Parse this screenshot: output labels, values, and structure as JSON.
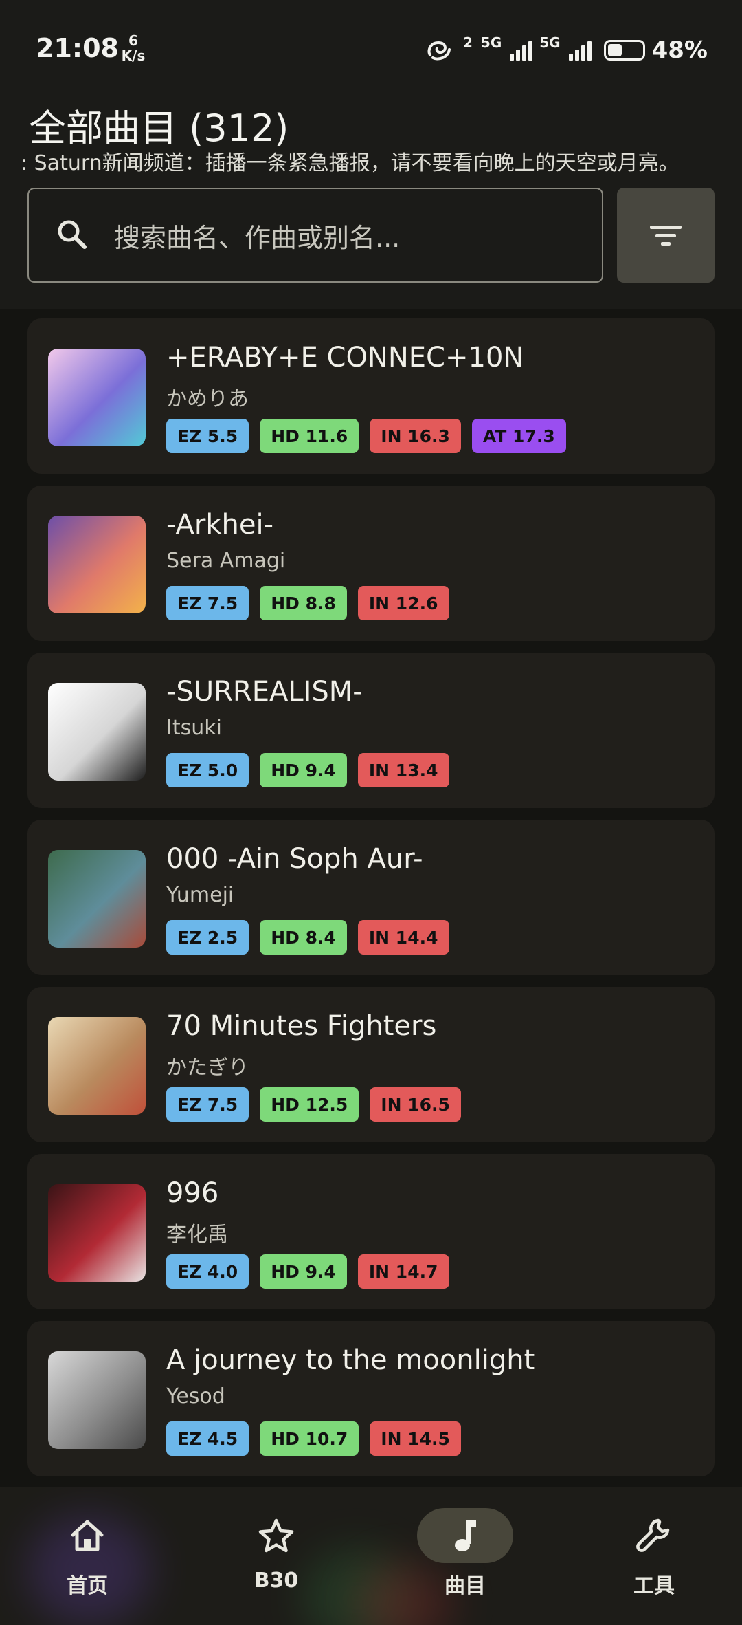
{
  "status_bar": {
    "time": "21:08",
    "speed_value": "6",
    "speed_unit": "K/s",
    "hd_label": "2",
    "network1": "5G",
    "network2": "5G",
    "battery_level": 0.48,
    "battery_percent": "48%"
  },
  "header": {
    "title": "全部曲目 (312)",
    "announcement": ": Saturn新闻频道：插播一条紧急播报，请不要看向晚上的天空或月亮。"
  },
  "search": {
    "placeholder": "搜索曲名、作曲或别名...",
    "icon": "search-icon",
    "filter_icon": "filter-icon"
  },
  "colors": {
    "EZ": "#6cb7ea",
    "HD": "#7ed97a",
    "IN": "#e35a5a",
    "AT": "#9a4ef0"
  },
  "songs": [
    {
      "title": "+ERABY+E CONNEC+10N",
      "artist": "かめりあ",
      "charts": [
        {
          "label": "EZ 5.5",
          "kind": "EZ"
        },
        {
          "label": "HD 11.6",
          "kind": "HD"
        },
        {
          "label": "IN 16.3",
          "kind": "IN"
        },
        {
          "label": "AT 17.3",
          "kind": "AT"
        }
      ],
      "cover": [
        "#f2c9ea",
        "#7b6fd8",
        "#53c9d6"
      ]
    },
    {
      "title": "-Arkhei-",
      "artist": "Sera Amagi",
      "charts": [
        {
          "label": "EZ 7.5",
          "kind": "EZ"
        },
        {
          "label": "HD 8.8",
          "kind": "HD"
        },
        {
          "label": "IN 12.6",
          "kind": "IN"
        }
      ],
      "cover": [
        "#6d4fa8",
        "#e07a6a",
        "#f3b24a"
      ]
    },
    {
      "title": "-SURREALISM-",
      "artist": "Itsuki",
      "charts": [
        {
          "label": "EZ 5.0",
          "kind": "EZ"
        },
        {
          "label": "HD 9.4",
          "kind": "HD"
        },
        {
          "label": "IN 13.4",
          "kind": "IN"
        }
      ],
      "cover": [
        "#ffffff",
        "#d6d6d6",
        "#1e1e1e"
      ]
    },
    {
      "title": "000 -Ain Soph Aur-",
      "artist": "Yumeji",
      "charts": [
        {
          "label": "EZ 2.5",
          "kind": "EZ"
        },
        {
          "label": "HD 8.4",
          "kind": "HD"
        },
        {
          "label": "IN 14.4",
          "kind": "IN"
        }
      ],
      "cover": [
        "#3e6b4d",
        "#5f8d9a",
        "#a84b3a"
      ]
    },
    {
      "title": "70 Minutes Fighters",
      "artist": "かたぎり",
      "charts": [
        {
          "label": "EZ 7.5",
          "kind": "EZ"
        },
        {
          "label": "HD 12.5",
          "kind": "HD"
        },
        {
          "label": "IN 16.5",
          "kind": "IN"
        }
      ],
      "cover": [
        "#e9d8b4",
        "#b98a5e",
        "#c0503a"
      ]
    },
    {
      "title": "996",
      "artist": "李化禹",
      "charts": [
        {
          "label": "EZ 4.0",
          "kind": "EZ"
        },
        {
          "label": "HD 9.4",
          "kind": "HD"
        },
        {
          "label": "IN 14.7",
          "kind": "IN"
        }
      ],
      "cover": [
        "#3a1416",
        "#b22a35",
        "#e8e3e3"
      ]
    },
    {
      "title": "A journey to the moonlight",
      "artist": "Yesod",
      "charts": [
        {
          "label": "EZ 4.5",
          "kind": "EZ"
        },
        {
          "label": "HD 10.7",
          "kind": "HD"
        },
        {
          "label": "IN 14.5",
          "kind": "IN"
        }
      ],
      "cover": [
        "#d8d8d8",
        "#8e8e8e",
        "#4a4a4a"
      ]
    }
  ],
  "nav": [
    {
      "label": "首页",
      "icon": "home-icon",
      "active": false
    },
    {
      "label": "B30",
      "icon": "star-icon",
      "active": false
    },
    {
      "label": "曲目",
      "icon": "music-note-icon",
      "active": true
    },
    {
      "label": "工具",
      "icon": "wrench-icon",
      "active": false
    }
  ]
}
